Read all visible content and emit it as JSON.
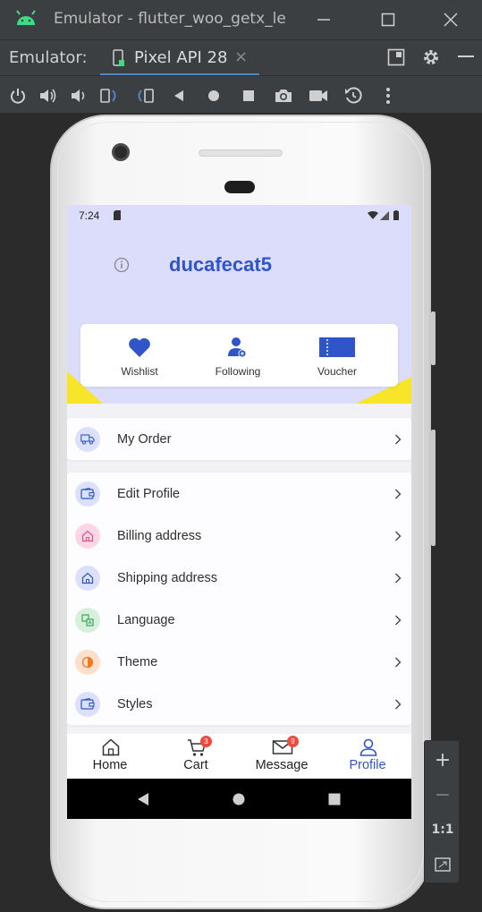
{
  "window": {
    "title": "Emulator - flutter_woo_getx_le",
    "minimize_icon": "minimize-icon",
    "maximize_icon": "maximize-icon",
    "close_icon": "close-icon"
  },
  "tabbar": {
    "label": "Emulator:",
    "device_tab": "Pixel API 28",
    "close_glyph": "×"
  },
  "toolbar": {
    "tools": [
      "power-icon",
      "volume-up-icon",
      "volume-down-icon",
      "rotate-left-icon",
      "rotate-right-icon",
      "back-icon",
      "home-icon",
      "overview-icon",
      "screenshot-icon",
      "record-icon",
      "snapshot-icon",
      "more-icon"
    ]
  },
  "status_bar": {
    "time": "7:24"
  },
  "profile": {
    "username": "ducafecat5",
    "shortcuts": [
      {
        "label": "Wishlist",
        "icon": "heart-icon"
      },
      {
        "label": "Following",
        "icon": "person-add-icon"
      },
      {
        "label": "Voucher",
        "icon": "ticket-icon"
      }
    ]
  },
  "menu": {
    "order": {
      "label": "My Order",
      "icon": "truck-icon",
      "color": "#dbe0fb"
    },
    "items": [
      {
        "label": "Edit Profile",
        "icon": "wallet-icon",
        "color": "#dbe0fb"
      },
      {
        "label": "Billing address",
        "icon": "home-outline-icon",
        "color": "#fbd6e7"
      },
      {
        "label": "Shipping address",
        "icon": "home-outline-icon",
        "color": "#dbe0fb"
      },
      {
        "label": "Language",
        "icon": "translate-icon",
        "color": "#d6f0dc"
      },
      {
        "label": "Theme",
        "icon": "contrast-icon",
        "color": "#fde0cc"
      },
      {
        "label": "Styles",
        "icon": "wallet-icon",
        "color": "#dbe0fb"
      }
    ]
  },
  "bottom_nav": {
    "items": [
      {
        "label": "Home",
        "icon": "home-outline-icon",
        "badge": ""
      },
      {
        "label": "Cart",
        "icon": "cart-icon",
        "badge": "3"
      },
      {
        "label": "Message",
        "icon": "mail-icon",
        "badge": "9"
      },
      {
        "label": "Profile",
        "icon": "person-icon",
        "badge": ""
      }
    ],
    "active": "Profile",
    "active_color": "#2f55c9"
  },
  "zoom": {
    "zoom_in": "+",
    "zoom_out": "−",
    "actual_size": "1:1"
  },
  "colors": {
    "accent": "#2f55c9",
    "header_bg": "#dcdcfb",
    "yellow": "#f7e52a",
    "badge_red": "#f0483e"
  }
}
